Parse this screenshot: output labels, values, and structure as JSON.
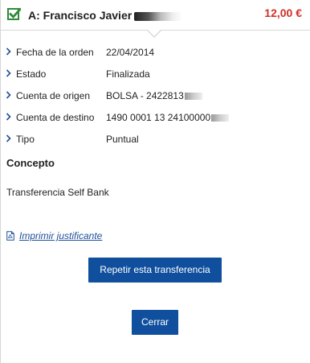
{
  "header": {
    "title": "A: Francisco Javier",
    "amount": "12,00 €",
    "status_icon": "checkbox-checked-icon",
    "accent_color": "#2f8a3a",
    "amount_color": "#d0302a"
  },
  "details": {
    "rows": [
      {
        "label": "Fecha de la orden",
        "value": "22/04/2014"
      },
      {
        "label": "Estado",
        "value": "Finalizada"
      },
      {
        "label": "Cuenta de origen",
        "value": "BOLSA - 2422813"
      },
      {
        "label": "Cuenta de destino",
        "value": "1490 0001 13 24100000"
      },
      {
        "label": "Tipo",
        "value": "Puntual"
      }
    ]
  },
  "concept": {
    "title": "Concepto",
    "text": "Transferencia Self Bank"
  },
  "print_link": {
    "label": "Imprimir justificante",
    "icon": "pdf-icon"
  },
  "buttons": {
    "repeat_label": "Repetir esta transferencia",
    "close_label": "Cerrar",
    "color": "#0f4f9d"
  }
}
